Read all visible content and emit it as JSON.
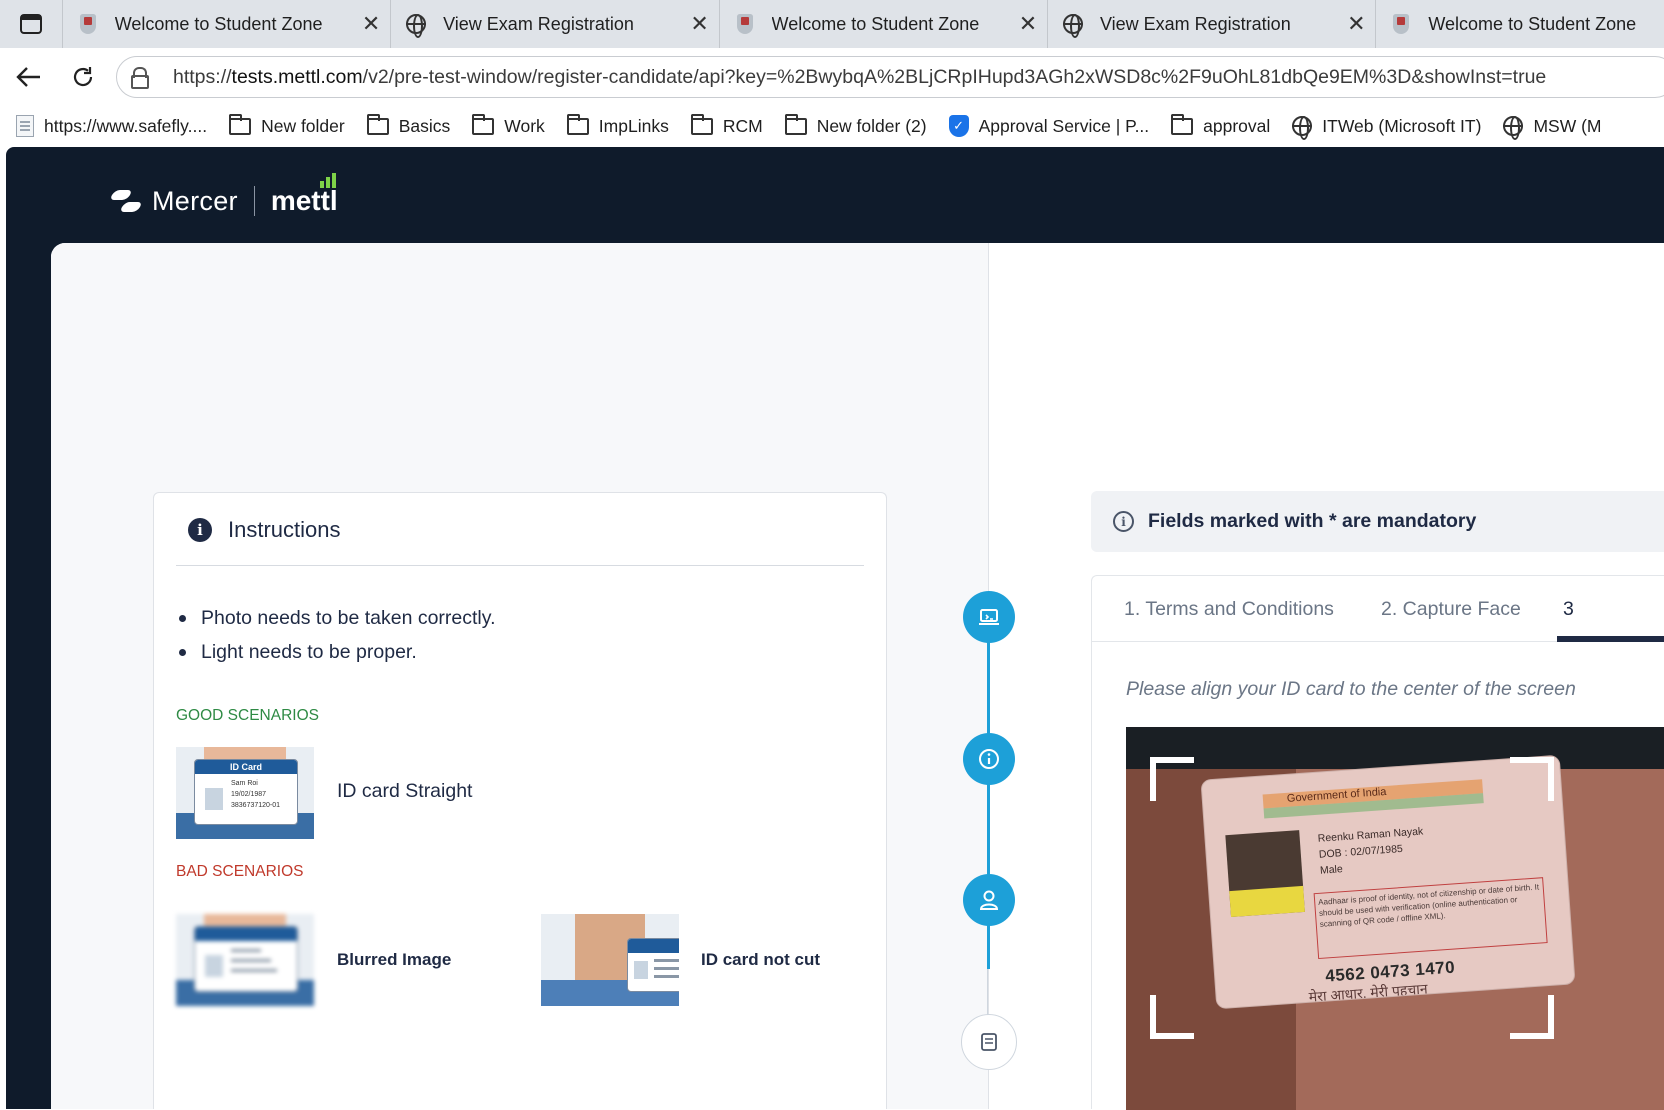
{
  "browser": {
    "tabs": [
      {
        "title": "Welcome to Student Zone",
        "icon": "shield-icon"
      },
      {
        "title": "View Exam Registration",
        "icon": "globe-icon"
      },
      {
        "title": "Welcome to Student Zone",
        "icon": "shield-icon"
      },
      {
        "title": "View Exam Registration",
        "icon": "globe-icon"
      },
      {
        "title": "Welcome to Student Zone",
        "icon": "shield-icon"
      }
    ],
    "close_glyph": "✕",
    "url_prefix": "https://",
    "url_host": "tests.mettl.com",
    "url_rest": "/v2/pre-test-window/register-candidate/api?key=%2BwybqA%2BLjCRpIHupd3AGh2xWSD8c%2F9uOhL81dbQe9EM%3D&showInst=true",
    "bookmarks": [
      {
        "label": "https://www.safefly....",
        "icon": "document-icon"
      },
      {
        "label": "New folder",
        "icon": "folder-icon"
      },
      {
        "label": "Basics",
        "icon": "folder-icon"
      },
      {
        "label": "Work",
        "icon": "folder-icon"
      },
      {
        "label": "ImpLinks",
        "icon": "folder-icon"
      },
      {
        "label": "RCM",
        "icon": "folder-icon"
      },
      {
        "label": "New folder (2)",
        "icon": "folder-icon"
      },
      {
        "label": "Approval Service | P...",
        "icon": "verified-shield-icon"
      },
      {
        "label": "approval",
        "icon": "folder-icon"
      },
      {
        "label": "ITWeb (Microsoft IT)",
        "icon": "globe-icon"
      },
      {
        "label": "MSW (M",
        "icon": "globe-icon"
      }
    ]
  },
  "brand": {
    "mercer": "Mercer",
    "mettl": "mettl"
  },
  "instructions": {
    "title": "Instructions",
    "bullets": [
      "Photo needs to be taken correctly.",
      "Light needs to be proper."
    ],
    "good_heading": "GOOD SCENARIOS",
    "bad_heading": "BAD SCENARIOS",
    "good": [
      {
        "label": "ID card Straight"
      }
    ],
    "bad": [
      {
        "label": "Blurred Image"
      },
      {
        "label": "ID card not cut"
      }
    ],
    "sample_card": {
      "header": "ID Card",
      "name": "Sam Roi",
      "dob": "19/02/1987",
      "number": "3836737120-01"
    }
  },
  "steps": [
    {
      "icon": "laptop-icon",
      "state": "completed"
    },
    {
      "icon": "info-icon",
      "state": "completed"
    },
    {
      "icon": "user-icon",
      "state": "completed"
    },
    {
      "icon": "document-icon",
      "state": "pending"
    }
  ],
  "form": {
    "notice": "Fields marked with * are mandatory",
    "tabs": [
      "1. Terms and Conditions",
      "2. Capture Face",
      "3"
    ],
    "active_tab_index": 2,
    "hint": "Please align your ID card to the center of the screen",
    "preview": {
      "gov_line": "Government of India",
      "name": "Reenku Raman Nayak",
      "dob": "DOB : 02/07/1985",
      "gender": "Male",
      "para": "Aadhaar is proof of identity, not of citizenship or date of birth. It should be used with verification (online authentication or scanning of QR code / offline XML).",
      "number": "4562 0473 1470",
      "tagline": "मेरा आधार, मेरी पहचान"
    }
  },
  "colors": {
    "header_bg": "#0f1b2b",
    "accent": "#1da0d8",
    "good": "#2e8a44",
    "bad": "#c0392b"
  }
}
